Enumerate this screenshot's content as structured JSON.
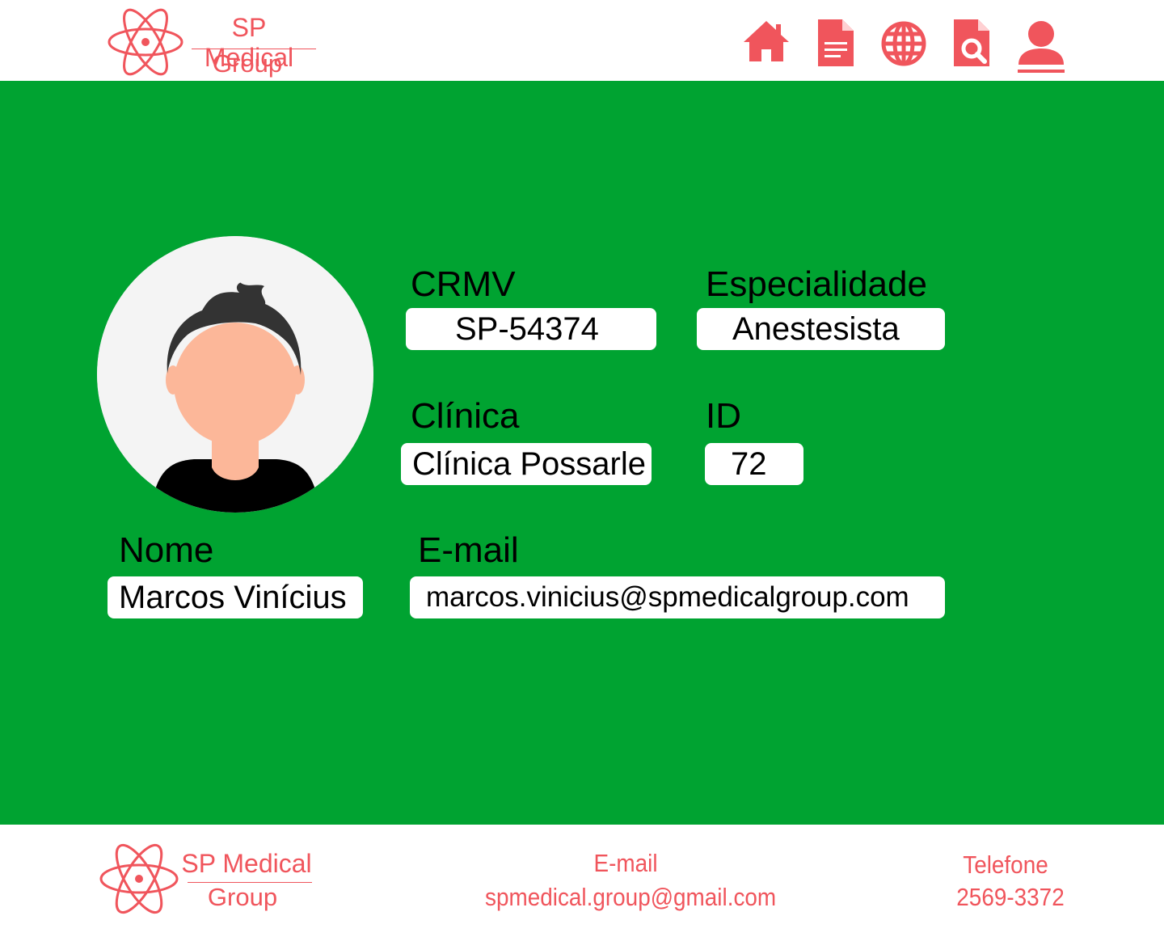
{
  "brand": {
    "name_line1": "SP Medical",
    "name_line2": "Group",
    "color": "#f0555c"
  },
  "nav": {
    "icons": [
      "home-icon",
      "document-icon",
      "globe-icon",
      "search-document-icon",
      "user-icon"
    ],
    "active": "user-icon"
  },
  "profile": {
    "crmv_label": "CRMV",
    "crmv_value": "SP-54374",
    "especialidade_label": "Especialidade",
    "especialidade_value": "Anestesista",
    "clinica_label": "Clínica",
    "clinica_value": "Clínica Possarle",
    "id_label": "ID",
    "id_value": "72",
    "nome_label": "Nome",
    "nome_value": "Marcos Vinícius",
    "email_label": "E-mail",
    "email_value": "marcos.vinicius@spmedicalgroup.com"
  },
  "footer": {
    "email_label": "E-mail",
    "email_value": "spmedical.group@gmail.com",
    "phone_label": "Telefone",
    "phone_value": "2569-3372"
  },
  "colors": {
    "main_bg": "#00a331",
    "accent": "#f0555c",
    "field_bg": "#ffffff"
  }
}
